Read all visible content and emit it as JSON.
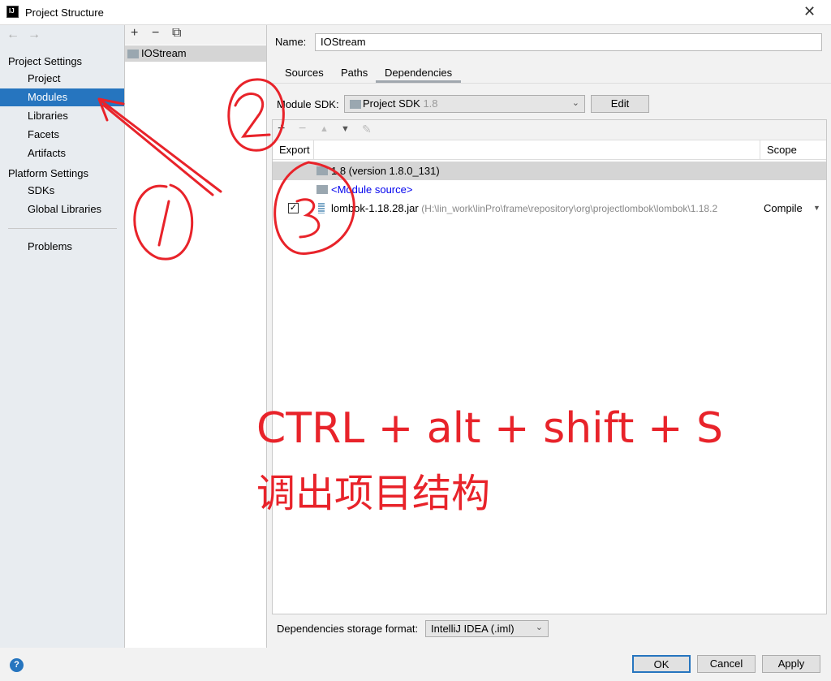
{
  "window": {
    "title": "Project Structure",
    "close": "✕",
    "logo": "IJ"
  },
  "sidebar": {
    "back": "←",
    "forward": "→",
    "sections": [
      {
        "label": "Project Settings",
        "items": [
          {
            "label": "Project"
          },
          {
            "label": "Modules",
            "selected": true
          },
          {
            "label": "Libraries"
          },
          {
            "label": "Facets"
          },
          {
            "label": "Artifacts"
          }
        ]
      },
      {
        "label": "Platform Settings",
        "items": [
          {
            "label": "SDKs"
          },
          {
            "label": "Global Libraries"
          }
        ]
      }
    ],
    "problems": "Problems"
  },
  "modules": {
    "add": "+",
    "remove": "−",
    "copy": "⧉",
    "items": [
      {
        "label": "IOStream"
      }
    ]
  },
  "main": {
    "name_label": "Name:",
    "name_value": "IOStream",
    "tabs": [
      {
        "label": "Sources"
      },
      {
        "label": "Paths"
      },
      {
        "label": "Dependencies",
        "active": true
      }
    ],
    "sdk_label": "Module SDK:",
    "sdk_value": "Project SDK",
    "sdk_version": "1.8",
    "edit_label": "Edit",
    "dep_toolbar": {
      "add": "+",
      "remove": "−",
      "up": "▲",
      "down": "▼",
      "edit": "✎"
    },
    "columns": {
      "export": "Export",
      "scope": "Scope"
    },
    "rows": [
      {
        "name": "1.8 (version 1.8.0_131)"
      },
      {
        "name": "<Module source>"
      },
      {
        "name": "lombok-1.18.28.jar",
        "path": "(H:\\lin_work\\linPro\\frame\\repository\\org\\projectlombok\\lombok\\1.18.2",
        "scope": "Compile",
        "checked": true
      }
    ],
    "storage_label": "Dependencies storage format:",
    "storage_value": "IntelliJ IDEA (.iml)"
  },
  "footer": {
    "help": "?",
    "ok": "OK",
    "cancel": "Cancel",
    "apply": "Apply"
  },
  "annotation": {
    "line1": "CTRL + alt + shift + S",
    "line2": "调出项目结构",
    "color": "#e8232a"
  },
  "colors": {
    "selection": "#2675bf",
    "link": "#0000ee"
  }
}
